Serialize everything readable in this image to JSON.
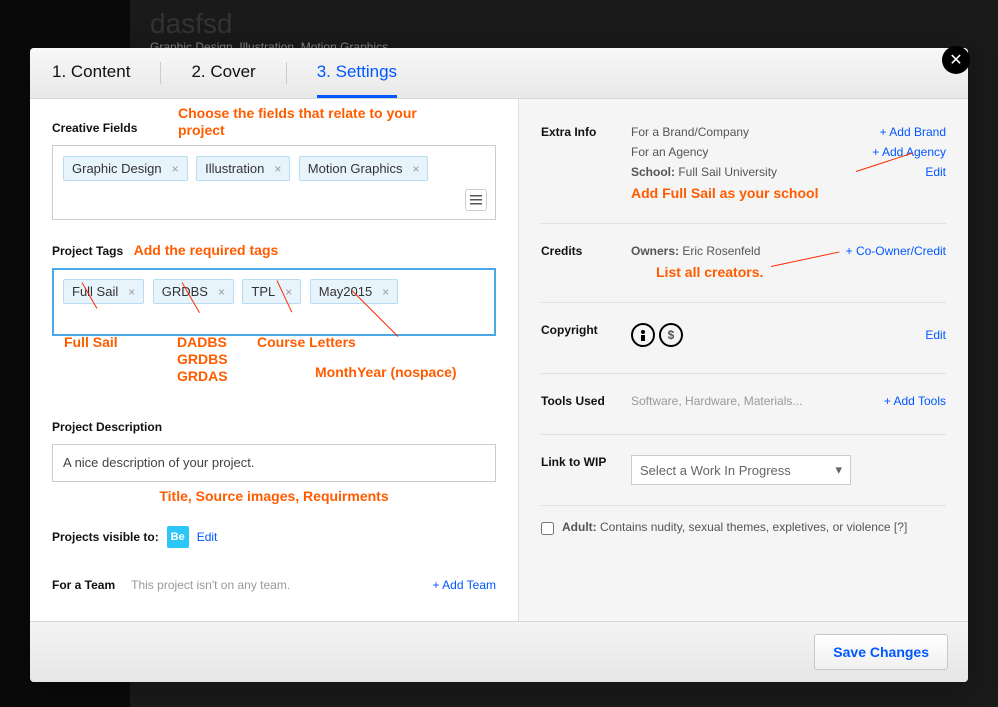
{
  "bg": {
    "title": "dasfsd",
    "subtitle": "Graphic Design, Illustration, Motion Graphics"
  },
  "tabs": [
    "1.  Content",
    "2.  Cover",
    "3.  Settings"
  ],
  "left": {
    "fields_label": "Creative Fields",
    "fields_note": "Choose the fields that relate to your project",
    "chips_fields": [
      "Graphic Design",
      "Illustration",
      "Motion Graphics"
    ],
    "tags_label": "Project Tags",
    "tags_note": "Add the required tags",
    "chips_tags": [
      "Full Sail",
      "GRDBS",
      "TPL",
      "May2015"
    ],
    "tag_anno_1": "Full Sail",
    "tag_anno_2": "DADBS\nGRDBS\nGRDAS",
    "tag_anno_3": "Course Letters",
    "tag_anno_4": "MonthYear (nospace)",
    "desc_label": "Project Description",
    "desc_value": "A nice description of your project.",
    "desc_note": "Title, Source images, Requirments",
    "visible_label": "Projects visible to:",
    "be": "Be",
    "edit": "Edit",
    "team_label": "For a Team",
    "team_text": "This project isn't on any team.",
    "add_team": "+ Add Team"
  },
  "right": {
    "extra_label": "Extra Info",
    "brand_text": "For a Brand/Company",
    "add_brand": "+ Add Brand",
    "agency_text": "For an Agency",
    "add_agency": "+ Add Agency",
    "school_key": "School:",
    "school_val": " Full Sail University",
    "edit": "Edit",
    "school_note": "Add Full Sail as your school",
    "credits_label": "Credits",
    "owners_key": "Owners: ",
    "owners_val": "Eric Rosenfeld",
    "add_co": "+ Co-Owner/Credit",
    "credits_note": "List all creators.",
    "copyright_label": "Copyright",
    "tools_label": "Tools Used",
    "tools_ph": "Software, Hardware, Materials...",
    "add_tools": "+ Add Tools",
    "wip_label": "Link to WIP",
    "wip_ph": "Select a Work In Progress",
    "adult_key": "Adult: ",
    "adult_text": "Contains nudity, sexual themes, expletives, or violence [?]"
  },
  "save": "Save Changes"
}
